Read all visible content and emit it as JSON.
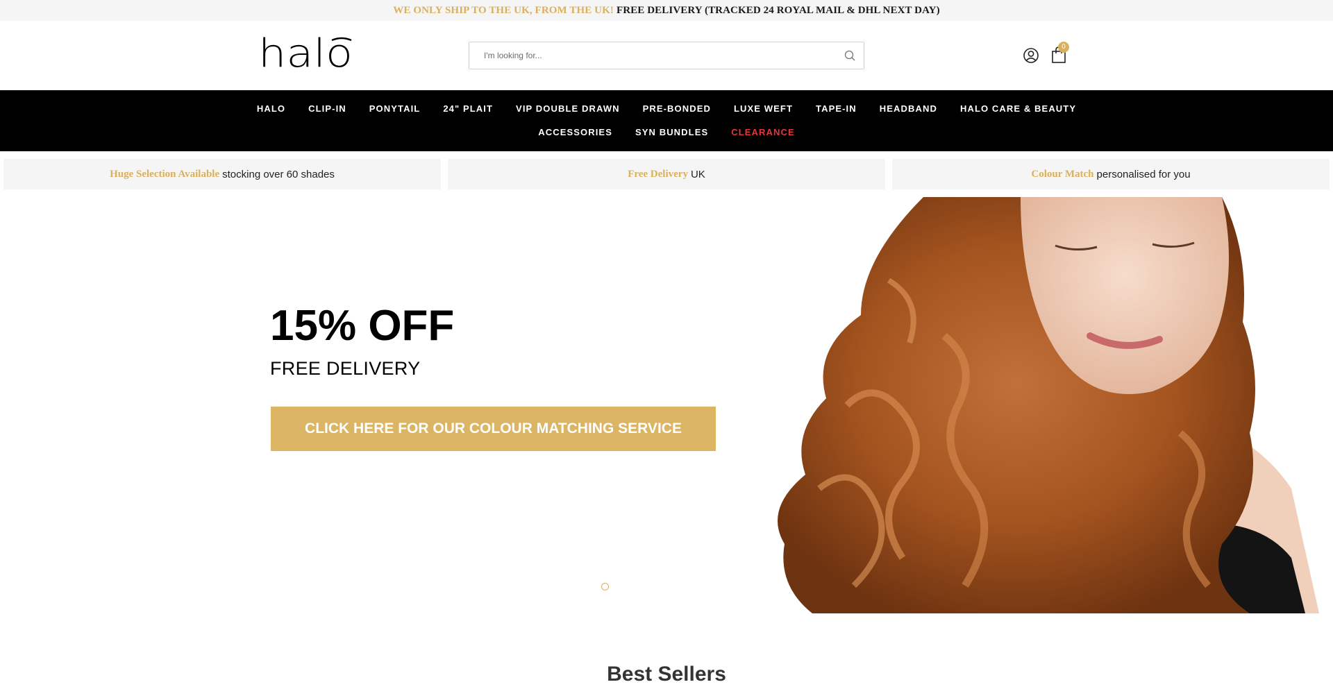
{
  "announcement": {
    "highlight": "WE ONLY SHIP TO THE UK, FROM THE UK!",
    "text": "FREE DELIVERY (TRACKED 24 ROYAL MAIL & DHL NEXT DAY)",
    "highlight_color": "#d9b05e"
  },
  "header": {
    "logo_text": "halo",
    "search_placeholder": "I'm looking for...",
    "account_icon": "user-circle-icon",
    "cart_icon": "shopping-bag-icon",
    "cart_count": "0"
  },
  "nav": {
    "row1": [
      "HALO",
      "CLIP-IN",
      "PONYTAIL",
      "24\" PLAIT",
      "VIP DOUBLE DRAWN",
      "PRE-BONDED",
      "LUXE WEFT",
      "TAPE-IN",
      "HEADBAND",
      "HALO CARE & BEAUTY"
    ],
    "row2": [
      "ACCESSORIES",
      "SYN BUNDLES",
      "CLEARANCE"
    ],
    "clearance_color": "#e2383b"
  },
  "usps": [
    {
      "highlight": "Huge Selection Available",
      "text": "stocking over 60 shades"
    },
    {
      "highlight": "Free Delivery",
      "text": "UK"
    },
    {
      "highlight": "Colour Match",
      "text": "personalised for you"
    }
  ],
  "hero": {
    "title": "15% OFF",
    "subtitle": "FREE DELIVERY",
    "cta": "CLICK HERE FOR OUR COLOUR MATCHING SERVICE",
    "cta_color": "#dbb563",
    "slides_total": 1,
    "active_slide": 1
  },
  "sections": {
    "best_sellers_title": "Best Sellers"
  },
  "colors": {
    "accent": "#d9b05e",
    "nav_background": "#000000",
    "usp_background": "#f5f5f5"
  }
}
